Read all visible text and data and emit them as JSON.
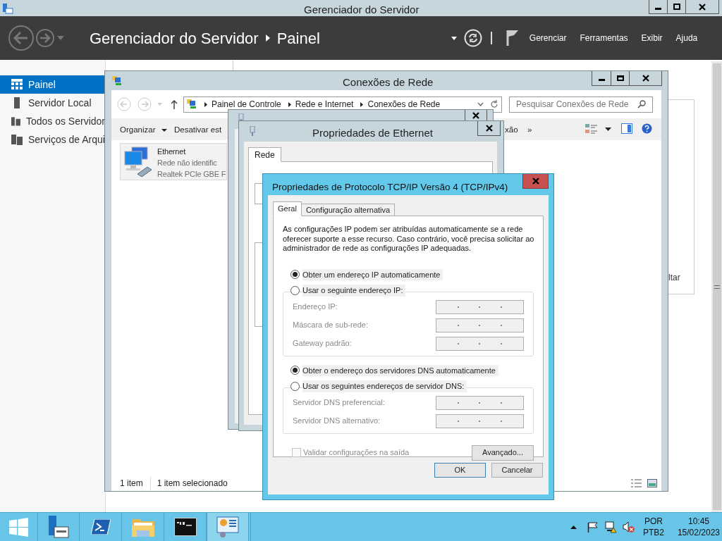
{
  "title_bar": {
    "title": "Gerenciador do Servidor"
  },
  "header": {
    "title": "Gerenciador do Servidor",
    "page": "Painel",
    "menus": [
      "Gerenciar",
      "Ferramentas",
      "Exibir",
      "Ajuda"
    ]
  },
  "sidebar": {
    "items": [
      {
        "label": "Painel",
        "selected": true
      },
      {
        "label": "Servidor Local",
        "selected": false
      },
      {
        "label": "Todos os Servidor",
        "selected": false
      },
      {
        "label": "Serviços de Arqui",
        "selected": false
      }
    ]
  },
  "background_panel": {
    "text": "ltar"
  },
  "network_window": {
    "title": "Conexões de Rede",
    "breadcrumb": [
      "Painel de Controle",
      "Rede e Internet",
      "Conexões de Rede"
    ],
    "search": {
      "placeholder": "Pesquisar Conexões de Rede"
    },
    "toolbar": [
      {
        "label": "Organizar",
        "dropdown": true
      },
      {
        "label": "Desativar est",
        "dropdown": false
      },
      {
        "label": "xão",
        "dropdown": false
      },
      {
        "label": "»",
        "dropdown": false
      }
    ],
    "items": [
      {
        "name": "Ethernet",
        "status": "Rede não identific",
        "adapter": "Realtek PCIe GBE F",
        "selected": true
      }
    ],
    "status_bar": [
      "1 item",
      "1 item selecionado"
    ]
  },
  "properties_window": {
    "title": "Propriedades de Ethernet",
    "tabs": [
      {
        "label": "Rede",
        "selected": true
      }
    ]
  },
  "tcp_dialog": {
    "title": "Propriedades de Protocolo TCP/IP Versão 4 (TCP/IPv4)",
    "tabs": [
      {
        "label": "Geral",
        "selected": true
      },
      {
        "label": "Configuração alternativa",
        "selected": false
      }
    ],
    "description": "As configurações IP podem ser atribuídas automaticamente se a rede oferecer suporte a esse recurso. Caso contrário, você precisa solicitar ao administrador de rede as configurações IP adequadas.",
    "ip_auto": {
      "label": "Obter um endereço IP automaticamente",
      "selected": true
    },
    "ip_manual": {
      "label": "Usar o seguinte endereço IP:",
      "selected": false
    },
    "ip_fields": [
      {
        "label": "Endereço IP:",
        "disabled": true
      },
      {
        "label": "Máscara de sub-rede:",
        "disabled": true
      },
      {
        "label": "Gateway padrão:",
        "disabled": true
      }
    ],
    "dns_auto": {
      "label": "Obter o endereço dos servidores DNS automaticamente",
      "selected": true
    },
    "dns_manual": {
      "label": "Usar os seguintes endereços de servidor DNS:",
      "selected": false
    },
    "dns_fields": [
      {
        "label": "Servidor DNS preferencial:",
        "disabled": true
      },
      {
        "label": "Servidor DNS alternativo:",
        "disabled": true
      }
    ],
    "validate": {
      "label": "Validar configurações na saída",
      "checked": false,
      "disabled": true
    },
    "advanced_button": "Avançado...",
    "buttons": [
      "OK",
      "Cancelar"
    ]
  },
  "taskbar": {
    "language": "POR",
    "layout": "PTB2",
    "time": "10:45",
    "date": "15/02/2023"
  }
}
